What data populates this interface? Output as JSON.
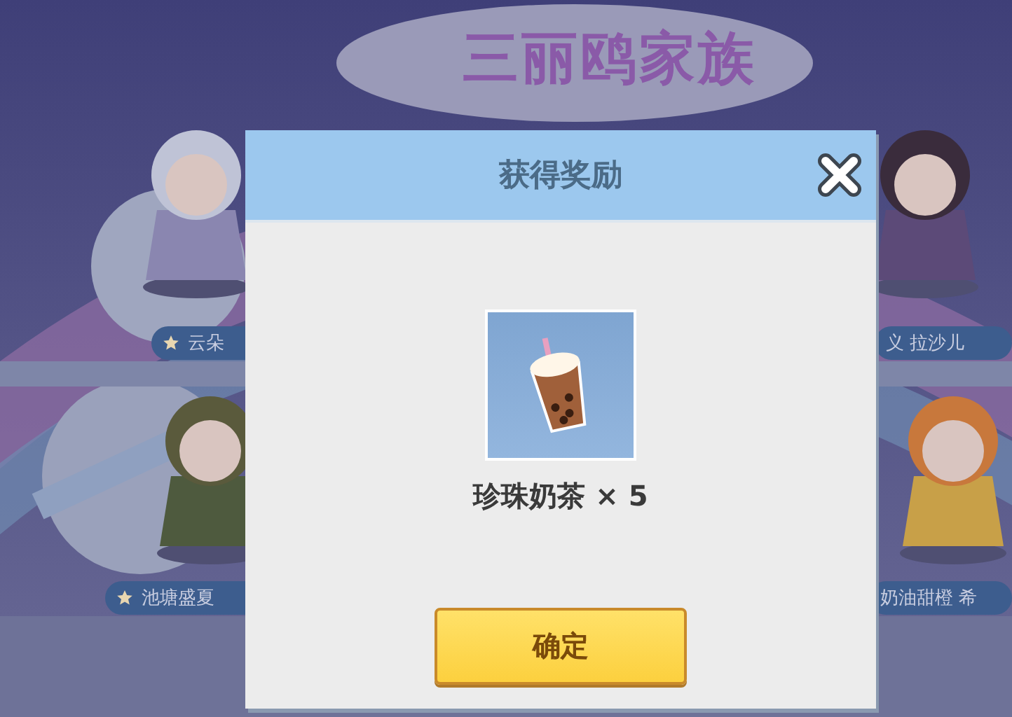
{
  "background": {
    "logo": "三丽鸥家族",
    "name_tags": [
      {
        "label": "云朵",
        "kind": "star"
      },
      {
        "label": "义 拉沙儿",
        "kind": "plain"
      },
      {
        "label": "池塘盛夏",
        "kind": "star"
      },
      {
        "label": "奶油甜橙 希",
        "kind": "plain"
      }
    ]
  },
  "dialog": {
    "title": "获得奖励",
    "reward": {
      "name": "珍珠奶茶 × 5"
    },
    "confirm_button": "确定"
  }
}
